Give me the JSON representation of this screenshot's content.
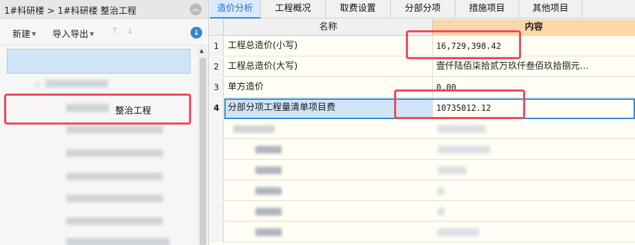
{
  "left": {
    "breadcrumb": "1#科研楼 > 1#科研楼  整治工程",
    "collapse_icon": "chevron-up-icon",
    "toolbar": {
      "new_label": "新建",
      "import_export_label": "导入导出"
    },
    "tree": {
      "selected_label": "整治工程"
    }
  },
  "tabs": [
    {
      "label": "造价分析"
    },
    {
      "label": "工程概况"
    },
    {
      "label": "取费设置"
    },
    {
      "label": "分部分项"
    },
    {
      "label": "措施项目"
    },
    {
      "label": "其他项目"
    }
  ],
  "active_tab": "造价分析",
  "grid": {
    "columns": {
      "name": "名称",
      "content": "内容"
    },
    "rows": [
      {
        "num": "1",
        "name": "工程总造价(小写)",
        "value": "16,729,398.42"
      },
      {
        "num": "2",
        "name": "工程总造价(大写)",
        "value": "壹仟陆佰柒拾贰万玖仟叁佰玖拾捌元…"
      },
      {
        "num": "3",
        "name": "单方造价",
        "value": "0.00"
      },
      {
        "num": "4",
        "name": "分部分项工程量清单项目费",
        "value": "10735012.12"
      }
    ]
  },
  "colors": {
    "accent": "#2f86d8",
    "header_highlight": "#fbd7ab",
    "annotation": "#f0475a",
    "selection": "#cfe4f7"
  }
}
